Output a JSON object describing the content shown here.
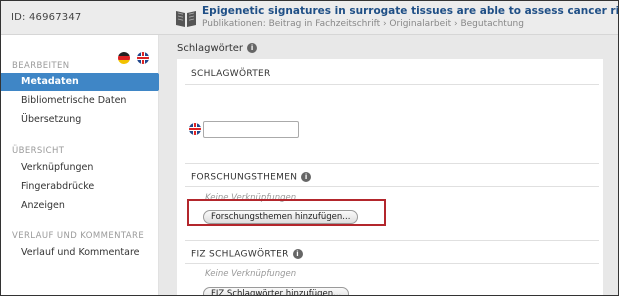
{
  "header": {
    "id_label": "ID: 46967347",
    "title": "Epigenetic signatures in surrogate tissues are able to assess cancer risk and indic",
    "subtitle": "Publikationen: Beitrag in Fachzeitschrift › Originalarbeit › Begutachtung"
  },
  "sidebar": {
    "flags": [
      "german-flag-icon",
      "uk-flag-icon"
    ],
    "section_bearbeiten": "BEARBEITEN",
    "items_bearbeiten": [
      "Metadaten",
      "Bibliometrische Daten",
      "Übersetzung"
    ],
    "section_uebersicht": "ÜBERSICHT",
    "items_uebersicht": [
      "Verknüpfungen",
      "Fingerabdrücke",
      "Anzeigen"
    ],
    "section_verlauf": "VERLAUF UND KOMMENTARE",
    "items_verlauf": [
      "Verlauf und Kommentare"
    ]
  },
  "main": {
    "title": "Schlagwörter",
    "schlagwoerter_head": "SCHLAGWÖRTER",
    "schlagwoerter_input_value": "",
    "forschung_head": "FORSCHUNGSTHEMEN",
    "forschung_empty": "Keine Verknüpfungen",
    "forschung_button": "Forschungsthemen hinzufügen...",
    "fiz_head": "FIZ SCHLAGWÖRTER",
    "fiz_empty": "Keine Verknüpfungen",
    "fiz_button": "FIZ Schlagwörter hinzufügen..."
  },
  "colors": {
    "active_nav": "#3f86c6",
    "title_blue": "#1f4f86",
    "highlight_red": "#b3262c"
  }
}
